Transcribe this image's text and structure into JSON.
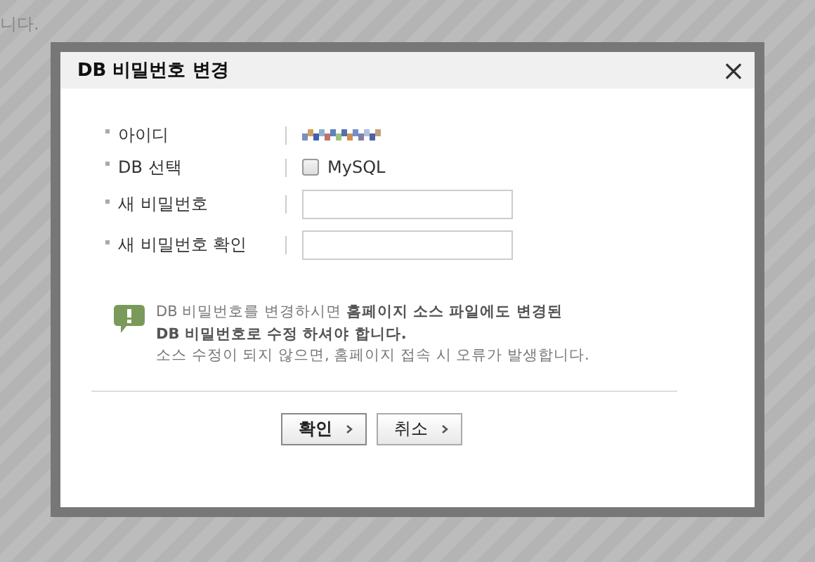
{
  "background_text": "니다.",
  "dialog": {
    "title": "DB 비밀번호 변경",
    "close": "×"
  },
  "fields": [
    {
      "kind": "masked",
      "label": "아이디"
    },
    {
      "kind": "checkbox",
      "label": "DB 선택",
      "option": "MySQL",
      "checked": false
    },
    {
      "kind": "input",
      "label": "새 비밀번호"
    },
    {
      "kind": "input",
      "label": "새 비밀번호 확인"
    }
  ],
  "notice": {
    "lines": [
      "DB 비밀번호를 변경하시면 **홈페이지 소스 파일에도 변경된**",
      "**DB 비밀번호로 수정 하셔야 합니다.**",
      "소스 수정이 되지 않으면, 홈페이지 접속 시 오류가 발생합니다."
    ]
  },
  "buttons": [
    "확인",
    "취소"
  ]
}
